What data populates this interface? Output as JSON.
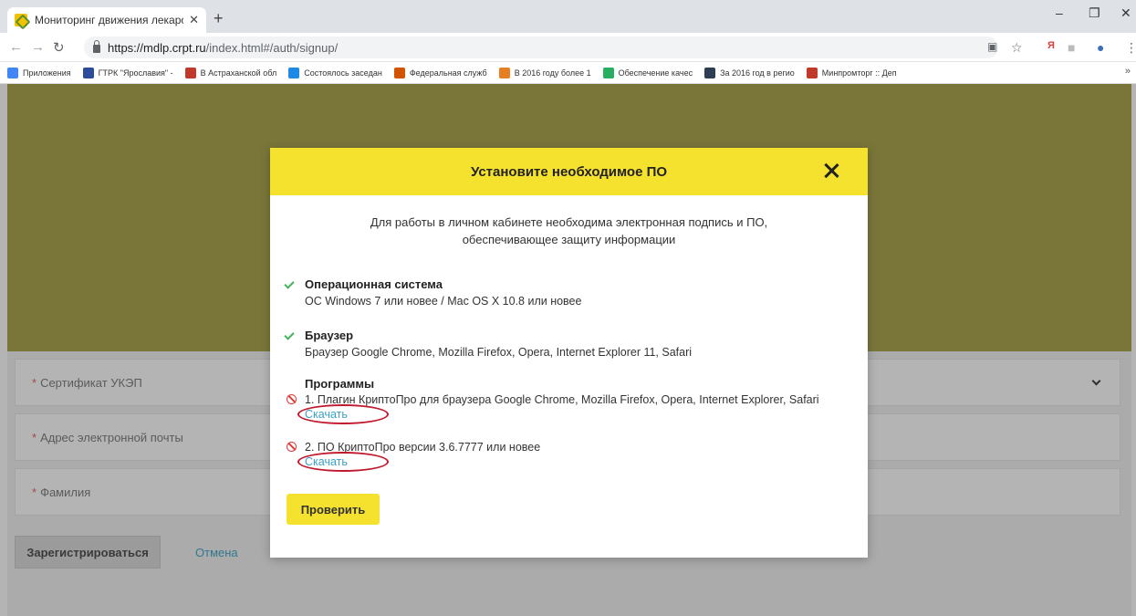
{
  "browser": {
    "tab_title": "Мониторинг движения лекарс",
    "tab_close": "✕",
    "new_tab": "+",
    "url_host": "https://mdlp.crpt.ru",
    "url_path": "/index.html#/auth/signup/",
    "window": {
      "minimize": "–",
      "maximize": "❐",
      "close": "✕"
    }
  },
  "bookmarks": [
    {
      "label": "Приложения",
      "color": "#4285f4"
    },
    {
      "label": "ГТРК \"Ярославия\" -",
      "color": "#2b4c9b"
    },
    {
      "label": "В Астраханской обл",
      "color": "#c0392b"
    },
    {
      "label": "Состоялось заседан",
      "color": "#1e88e5"
    },
    {
      "label": "Федеральная служб",
      "color": "#d35400"
    },
    {
      "label": "В 2016 году более 1",
      "color": "#e67e22"
    },
    {
      "label": "Обеспечение качес",
      "color": "#27ae60"
    },
    {
      "label": "За 2016 год в регио",
      "color": "#2c3e50"
    },
    {
      "label": "Минпромторг :: Деп",
      "color": "#c0392b"
    }
  ],
  "bookmarks_more": "»",
  "form": {
    "cert_label": "Сертификат УКЭП",
    "email_label": "Адрес электронной почты",
    "surname_label": "Фамилия",
    "required_mark": "*",
    "register_button": "Зарегистрироваться",
    "cancel_link": "Отмена"
  },
  "modal": {
    "title": "Установите необходимое ПО",
    "intro_line1": "Для работы в личном кабинете необходима электронная подпись и ПО,",
    "intro_line2": "обеспечивающее защиту информации",
    "os_title": "Операционная система",
    "os_text": "ОС Windows 7 или новее / Mac OS X 10.8 или новее",
    "browser_title": "Браузер",
    "browser_text": "Браузер Google Chrome, Mozilla Firefox, Opera, Internet Explorer 11, Safari",
    "programs_title": "Программы",
    "program1": "1. Плагин КриптоПро для браузера Google Chrome, Mozilla Firefox, Opera, Internet Explorer, Safari",
    "program2": "2. ПО КриптоПро версии 3.6.7777 или новее",
    "download_label": "Скачать",
    "check_button": "Проверить"
  },
  "colors": {
    "accent_yellow": "#f5e22f",
    "banner_olive": "#a6a044",
    "link_blue": "#3aa0c8",
    "error_red": "#e23a3a",
    "ok_green": "#45b35a"
  }
}
